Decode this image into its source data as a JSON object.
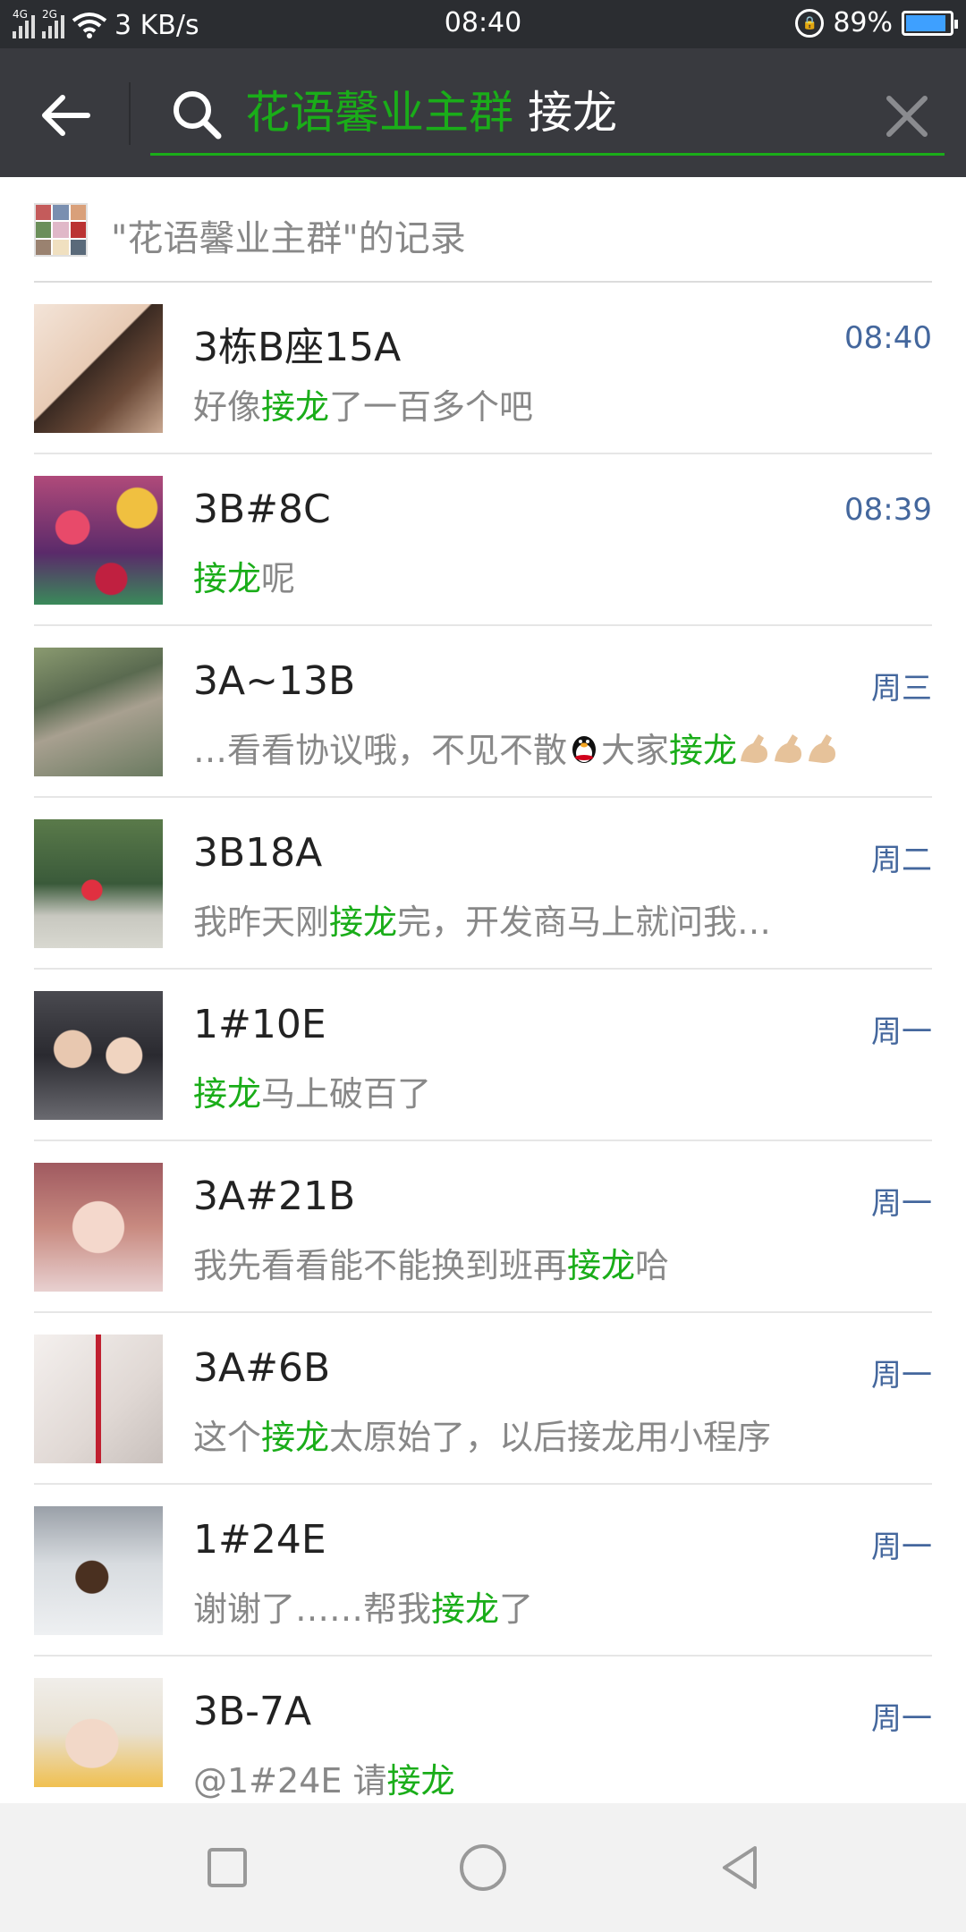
{
  "status_bar": {
    "network_left": "4G",
    "network_right": "2G",
    "speed": "3 KB/s",
    "time": "08:40",
    "battery": "89%"
  },
  "search": {
    "tag": "花语馨业主群",
    "query": "接龙"
  },
  "records_header": {
    "title": "\"花语馨业主群\"的记录"
  },
  "colors": {
    "highlight": "#1aad19",
    "time": "#44679d",
    "header_bg": "#393a3f",
    "status_bg": "#2b2d31"
  },
  "results": [
    {
      "name": "3栋B座15A",
      "time": "08:40",
      "pre": "好像",
      "hl": "接龙",
      "post": "了一百多个吧"
    },
    {
      "name": "3B#8C",
      "time": "08:39",
      "pre": "",
      "hl": "接龙",
      "post": "呢"
    },
    {
      "name": "3A~13B",
      "time": "周三",
      "pre": "…看看协议哦，不见不散",
      "hl": "接龙",
      "post": "",
      "pre2": "大家"
    },
    {
      "name": "3B18A",
      "time": "周二",
      "pre": "我昨天刚",
      "hl": "接龙",
      "post": "完，开发商马上就问我…"
    },
    {
      "name": "1#10E",
      "time": "周一",
      "pre": "",
      "hl": "接龙",
      "post": "马上破百了"
    },
    {
      "name": "3A#21B",
      "time": "周一",
      "pre": "我先看看能不能换到班再",
      "hl": "接龙",
      "post": "哈"
    },
    {
      "name": "3A#6B",
      "time": "周一",
      "pre": "这个",
      "hl": "接龙",
      "post": "太原始了，以后接龙用小程序"
    },
    {
      "name": "1#24E",
      "time": "周一",
      "pre": "谢谢了……帮我",
      "hl": "接龙",
      "post": "了"
    },
    {
      "name": "3B-7A",
      "time": "周一",
      "pre": "@1#24E 请",
      "hl": "接龙",
      "post": ""
    }
  ]
}
